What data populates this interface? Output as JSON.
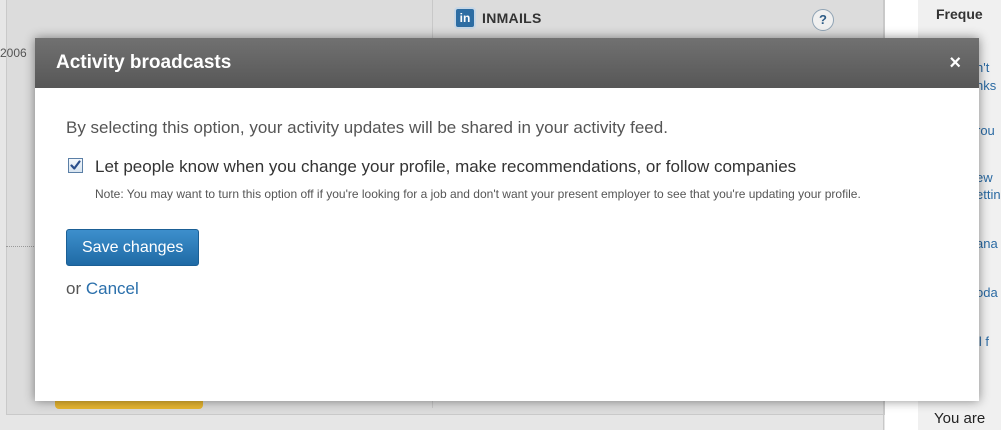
{
  "background": {
    "year_fragment": "2006",
    "inmails": {
      "badge": "in",
      "label": "INMAILS",
      "help": "?"
    },
    "sidebar": {
      "title": "Freque",
      "lines": [
        "n't",
        "nks",
        "rou",
        "ew",
        "ettin",
        "ana",
        "oda",
        "ll f"
      ],
      "footer": "You are"
    }
  },
  "modal": {
    "title": "Activity broadcasts",
    "close": "×",
    "description": "By selecting this option, your activity updates will be shared in your activity feed.",
    "option": {
      "checked": true,
      "label": "Let people know when you change your profile, make recommendations, or follow companies",
      "note": "Note: You may want to turn this option off if you're looking for a job and don't want your present employer to see that you're updating your profile."
    },
    "save_label": "Save changes",
    "or_text": "or",
    "cancel_label": "Cancel"
  },
  "colors": {
    "header": "#636363",
    "primary_button": "#2a7dbd",
    "link": "#2a6fab"
  }
}
